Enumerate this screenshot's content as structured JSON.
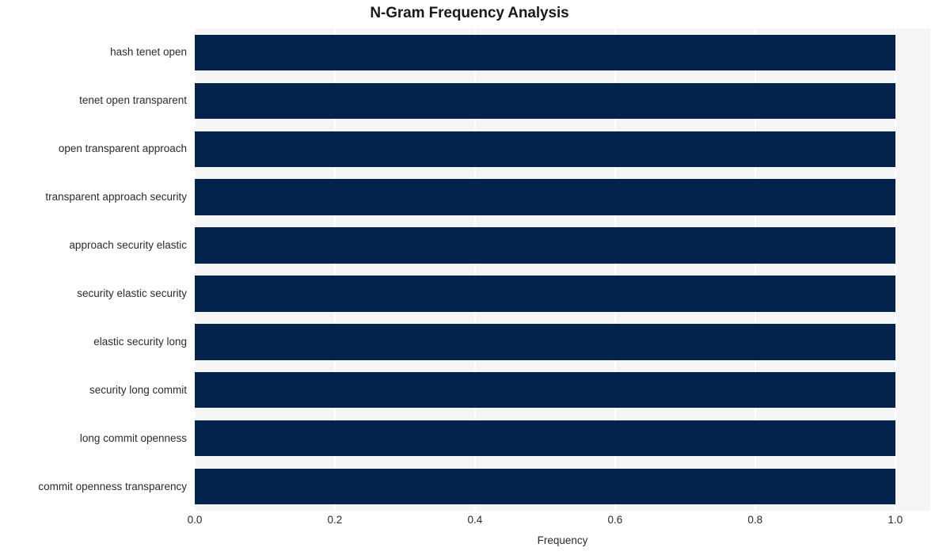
{
  "chart_data": {
    "type": "bar",
    "orientation": "horizontal",
    "title": "N-Gram Frequency Analysis",
    "xlabel": "Frequency",
    "ylabel": "",
    "xlim": [
      0.0,
      1.05
    ],
    "xticks": [
      "0.0",
      "0.2",
      "0.4",
      "0.6",
      "0.8",
      "1.0"
    ],
    "xtick_values": [
      0.0,
      0.2,
      0.4,
      0.6,
      0.8,
      1.0
    ],
    "grid": true,
    "legend": "none",
    "bar_color": "#03224c",
    "plot_background": "#f5f5f6",
    "categories": [
      "hash tenet open",
      "tenet open transparent",
      "open transparent approach",
      "transparent approach security",
      "approach security elastic",
      "security elastic security",
      "elastic security long",
      "security long commit",
      "long commit openness",
      "commit openness transparency"
    ],
    "values": [
      1.0,
      1.0,
      1.0,
      1.0,
      1.0,
      1.0,
      1.0,
      1.0,
      1.0,
      1.0
    ]
  }
}
